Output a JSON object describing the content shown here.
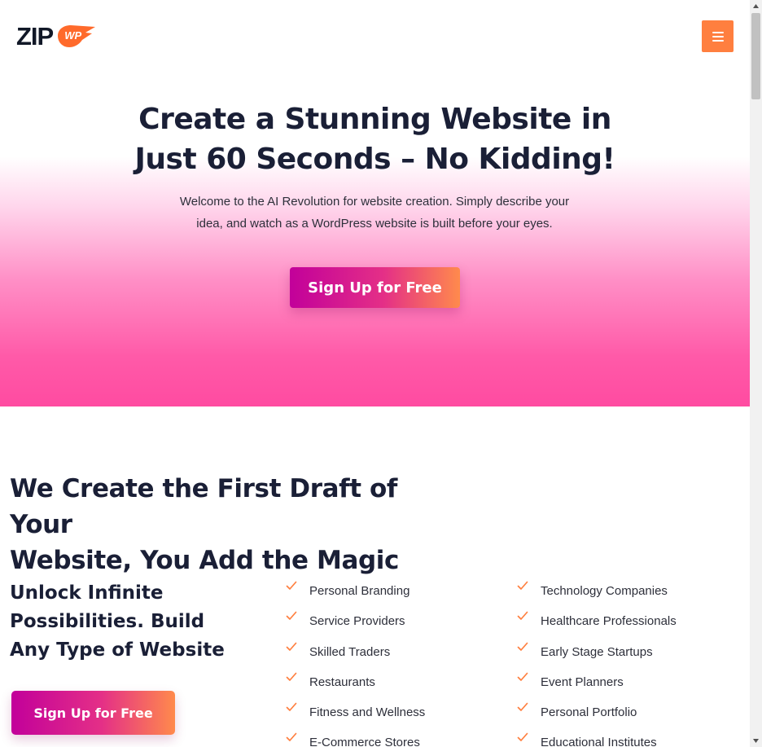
{
  "header": {
    "logo_text": "ZIP",
    "logo_badge": "WP",
    "menu_icon": "hamburger-icon"
  },
  "hero": {
    "title_line1": "Create a Stunning Website in",
    "title_line2": "Just 60 Seconds – No Kidding!",
    "subtitle_line1": "Welcome to the AI Revolution for website creation. Simply describe your",
    "subtitle_line2": "idea, and watch as a WordPress website is built before your eyes.",
    "cta_label": "Sign Up for Free"
  },
  "section": {
    "title_line1": "We Create the First Draft of Your",
    "title_line2": "Website, You Add the Magic",
    "unlock_line1": "Unlock Infinite",
    "unlock_line2": "Possibilities. Build",
    "unlock_line3": "Any Type of Website",
    "cta_label": "Sign Up for Free",
    "check_icon": "check-icon",
    "check_color": "#ff7f3f",
    "list_col1": [
      "Personal Branding",
      "Service Providers",
      "Skilled Traders",
      "Restaurants",
      "Fitness and Wellness",
      "E-Commerce Stores"
    ],
    "list_col2": [
      "Technology Companies",
      "Healthcare Professionals",
      "Early Stage Startups",
      "Event Planners",
      "Personal Portfolio",
      "Educational Institutes"
    ]
  },
  "colors": {
    "accent": "#ff7f3f",
    "gradient_start": "#c2009a",
    "gradient_end": "#ff8a4c",
    "hero_pink": "#ff4ba1",
    "heading": "#1a1f36"
  }
}
